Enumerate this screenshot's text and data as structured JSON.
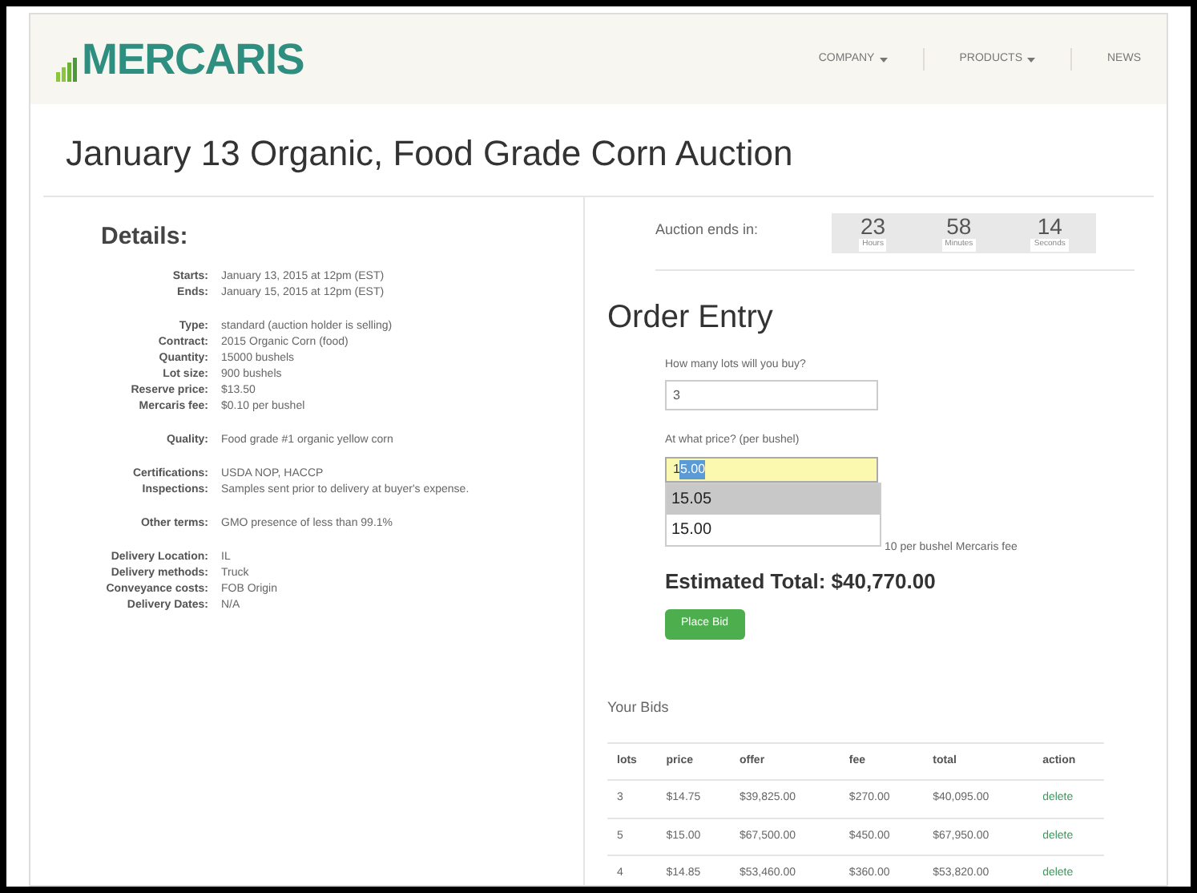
{
  "logo": {
    "text": "MERCARIS"
  },
  "nav": [
    {
      "label": "COMPANY",
      "dropdown": true
    },
    {
      "label": "PRODUCTS",
      "dropdown": true
    },
    {
      "label": "NEWS",
      "dropdown": false
    }
  ],
  "title": "January 13 Organic, Food Grade Corn Auction",
  "details": {
    "heading": "Details:",
    "groups": [
      [
        {
          "label": "Starts:",
          "value": "January 13, 2015 at 12pm (EST)"
        },
        {
          "label": "Ends:",
          "value": "January 15, 2015 at 12pm (EST)"
        }
      ],
      [
        {
          "label": "Type:",
          "value": "standard (auction holder is selling)"
        },
        {
          "label": "Contract:",
          "value": "2015 Organic Corn (food)"
        },
        {
          "label": "Quantity:",
          "value": "15000 bushels"
        },
        {
          "label": "Lot size:",
          "value": "900 bushels"
        },
        {
          "label": "Reserve price:",
          "value": "$13.50"
        },
        {
          "label": "Mercaris fee:",
          "value": "$0.10 per bushel"
        }
      ],
      [
        {
          "label": "Quality:",
          "value": "Food grade #1 organic yellow corn"
        }
      ],
      [
        {
          "label": "Certifications:",
          "value": "USDA NOP, HACCP"
        },
        {
          "label": "Inspections:",
          "value": "Samples sent prior to delivery at buyer's expense."
        }
      ],
      [
        {
          "label": "Other terms:",
          "value": "GMO presence of less than 99.1%"
        }
      ],
      [
        {
          "label": "Delivery Location:",
          "value": "IL"
        },
        {
          "label": "Delivery methods:",
          "value": "Truck"
        },
        {
          "label": "Conveyance costs:",
          "value": "FOB Origin"
        },
        {
          "label": "Delivery Dates:",
          "value": "N/A"
        }
      ]
    ]
  },
  "countdown": {
    "label": "Auction ends in:",
    "units": [
      {
        "value": "23",
        "unit": "Hours"
      },
      {
        "value": "58",
        "unit": "Minutes"
      },
      {
        "value": "14",
        "unit": "Seconds"
      }
    ]
  },
  "order_entry": {
    "heading": "Order Entry",
    "lots_label": "How many lots will you buy?",
    "lots_value": "3",
    "price_label": "At what price? (per bushel)",
    "price_typed": "1",
    "price_completion": "5.00",
    "suggestions": [
      {
        "text": "15.05",
        "selected": true
      },
      {
        "text": "15.00",
        "selected": false
      }
    ],
    "fee_note": "10 per bushel Mercaris fee",
    "estimated_total": "Estimated Total: $40,770.00",
    "button": "Place Bid"
  },
  "bids": {
    "heading": "Your Bids",
    "columns": [
      "lots",
      "price",
      "offer",
      "fee",
      "total",
      "action"
    ],
    "rows": [
      [
        "3",
        "$14.75",
        "$39,825.00",
        "$270.00",
        "$40,095.00",
        "delete"
      ],
      [
        "5",
        "$15.00",
        "$67,500.00",
        "$450.00",
        "$67,950.00",
        "delete"
      ],
      [
        "4",
        "$14.85",
        "$53,460.00",
        "$360.00",
        "$53,820.00",
        "delete"
      ]
    ]
  }
}
